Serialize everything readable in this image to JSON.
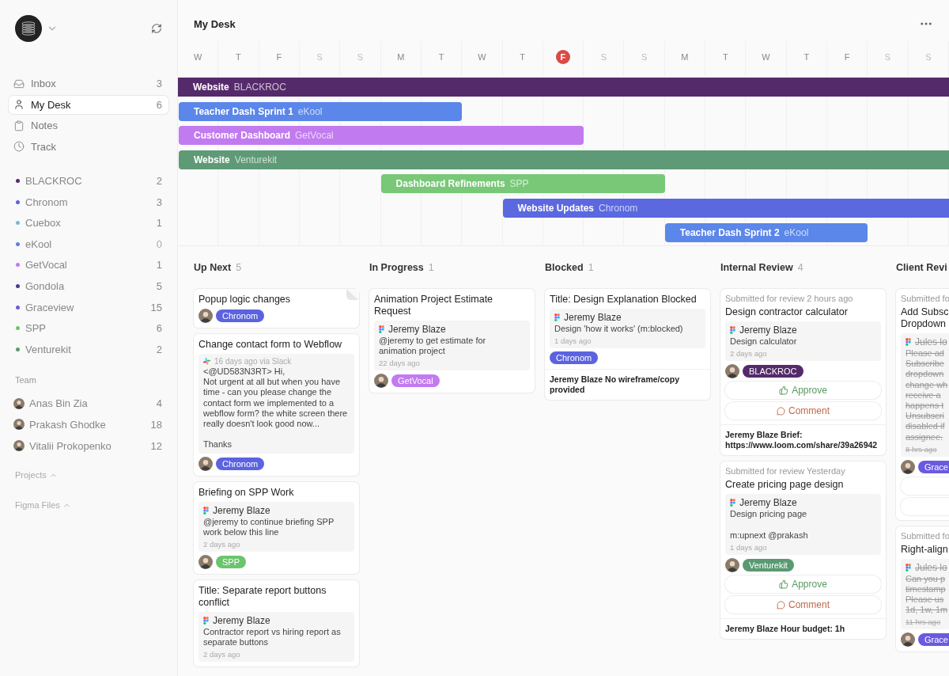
{
  "sidebar": {
    "nav": [
      {
        "kind": "inbox",
        "label": "Inbox",
        "count": "3",
        "selected": false
      },
      {
        "kind": "desk",
        "label": "My Desk",
        "count": "6",
        "selected": true
      },
      {
        "kind": "notes",
        "label": "Notes",
        "selected": false
      },
      {
        "kind": "track",
        "label": "Track",
        "selected": false
      }
    ],
    "projects": [
      {
        "label": "BLACKROC",
        "count": "2",
        "color": "#552a6a"
      },
      {
        "label": "Chronom",
        "count": "3",
        "color": "#5b63e0"
      },
      {
        "label": "Cuebox",
        "count": "1",
        "color": "#7ab8d6"
      },
      {
        "label": "eKool",
        "count": "0",
        "color": "#5b80e0"
      },
      {
        "label": "GetVocal",
        "count": "1",
        "color": "#c27af0"
      },
      {
        "label": "Gondola",
        "count": "5",
        "color": "#3f3f8f"
      },
      {
        "label": "Graceview",
        "count": "15",
        "color": "#6a5ae0"
      },
      {
        "label": "SPP",
        "count": "6",
        "color": "#6cc46e"
      },
      {
        "label": "Venturekit",
        "count": "2",
        "color": "#5a9a72"
      }
    ],
    "team": {
      "title": "Team",
      "members": [
        {
          "name": "Anas Bin Zia",
          "count": "4"
        },
        {
          "name": "Prakash Ghodke",
          "count": "18"
        },
        {
          "name": "Vitalii Prokopenko",
          "count": "12"
        }
      ]
    },
    "sections": [
      {
        "label": "Projects",
        "expanded": false
      },
      {
        "label": "Figma Files",
        "expanded": false
      }
    ]
  },
  "header": {
    "title": "My Desk"
  },
  "timeline": {
    "days": [
      {
        "label": "W",
        "weekend": false,
        "today": false
      },
      {
        "label": "T",
        "weekend": false,
        "today": false
      },
      {
        "label": "F",
        "weekend": false,
        "today": false
      },
      {
        "label": "S",
        "weekend": true,
        "today": false
      },
      {
        "label": "S",
        "weekend": true,
        "today": false
      },
      {
        "label": "M",
        "weekend": false,
        "today": false
      },
      {
        "label": "T",
        "weekend": false,
        "today": false
      },
      {
        "label": "W",
        "weekend": false,
        "today": false
      },
      {
        "label": "T",
        "weekend": false,
        "today": false
      },
      {
        "label": "F",
        "weekend": false,
        "today": true
      },
      {
        "label": "S",
        "weekend": true,
        "today": false
      },
      {
        "label": "S",
        "weekend": true,
        "today": false
      },
      {
        "label": "M",
        "weekend": false,
        "today": false
      },
      {
        "label": "T",
        "weekend": false,
        "today": false
      },
      {
        "label": "W",
        "weekend": false,
        "today": false
      },
      {
        "label": "T",
        "weekend": false,
        "today": false
      },
      {
        "label": "F",
        "weekend": false,
        "today": false
      },
      {
        "label": "S",
        "weekend": true,
        "today": false
      },
      {
        "label": "S",
        "weekend": true,
        "today": false
      }
    ],
    "bars": [
      {
        "title": "Website",
        "project": "BLACKROC",
        "color": "#552a6a"
      },
      {
        "title": "Teacher Dash Sprint 1",
        "project": "eKool",
        "color": "#5b86ea"
      },
      {
        "title": "Customer Dashboard",
        "project": "GetVocal",
        "color": "#c27af0"
      },
      {
        "title": "Website",
        "project": "Venturekit",
        "color": "#5e9a76"
      },
      {
        "title": "Dashboard Refinements",
        "project": "SPP",
        "color": "#78c878"
      },
      {
        "title": "Website Updates",
        "project": "Chronom",
        "color": "#5b68e0"
      },
      {
        "title": "Teacher Dash Sprint 2",
        "project": "eKool",
        "color": "#5b86ea"
      }
    ]
  },
  "board": [
    {
      "title": "Up Next",
      "count": "5",
      "cards": [
        {
          "title": "Popup logic changes",
          "folded": true,
          "avatar": true,
          "tag": {
            "label": "Chronom",
            "color": "#5b63e0"
          }
        },
        {
          "title": "Change contact form to Webflow",
          "folded": false,
          "note": {
            "kind": "slack",
            "meta": "16 days ago via Slack",
            "text": "<@UD583N3RT> Hi,\nNot urgent at all but when you have time - can you please change the contact form we implemented to a webflow form? the white screen there really doesn't look good now...\n\nThanks",
            "struck": false
          },
          "avatar": true,
          "tag": {
            "label": "Chronom",
            "color": "#5b63e0"
          }
        },
        {
          "title": "Briefing on SPP Work",
          "folded": false,
          "note": {
            "kind": "figma",
            "author": "Jeremy Blaze",
            "text": "@jeremy to continue briefing SPP work below this line",
            "time": "2 days ago",
            "struck": false
          },
          "avatar": true,
          "tag": {
            "label": "SPP",
            "color": "#6cc46e"
          }
        },
        {
          "title": "Title: Separate report buttons conflict",
          "folded": false,
          "note": {
            "kind": "figma",
            "author": "Jeremy Blaze",
            "text": "Contractor report vs hiring report as separate buttons",
            "time": "2 days ago",
            "struck": false
          },
          "avatar": false
        }
      ]
    },
    {
      "title": "In Progress",
      "count": "1",
      "cards": [
        {
          "title": "Animation Project Estimate Request",
          "folded": false,
          "note": {
            "kind": "figma",
            "author": "Jeremy Blaze",
            "text": "@jeremy to get estimate for animation project",
            "time": "22 days ago",
            "struck": false
          },
          "avatar": true,
          "tag": {
            "label": "GetVocal",
            "color": "#c27af0"
          }
        }
      ]
    },
    {
      "title": "Blocked",
      "count": "1",
      "cards": [
        {
          "title": "Title: Design Explanation Blocked",
          "folded": false,
          "note": {
            "kind": "figma",
            "author": "Jeremy Blaze",
            "text": "Design 'how it works' (m:blocked)",
            "time": "1 days ago",
            "struck": false
          },
          "avatar": false,
          "tag": {
            "label": "Chronom",
            "color": "#5b63e0"
          },
          "footer": "Jeremy Blaze No wireframe/copy provided"
        }
      ]
    },
    {
      "title": "Internal Review",
      "count": "4",
      "cards": [
        {
          "submitted": "Submitted for review 2 hours ago",
          "title": "Design contractor calculator",
          "folded": false,
          "note": {
            "kind": "figma",
            "author": "Jeremy Blaze",
            "text": "Design calculator",
            "time": "2 days ago",
            "struck": false
          },
          "avatar": true,
          "tag": {
            "label": "BLACKROC",
            "color": "#552a6a"
          },
          "actions": [
            {
              "kind": "approve",
              "label": "Approve"
            },
            {
              "kind": "comment",
              "label": "Comment"
            }
          ],
          "footer": "Jeremy Blaze Brief: https://www.loom.com/share/39a26942"
        },
        {
          "submitted": "Submitted for review Yesterday",
          "title": "Create pricing page design",
          "folded": false,
          "note": {
            "kind": "figma",
            "author": "Jeremy Blaze",
            "text": "Design pricing page\n\nm:upnext @prakash",
            "time": "1 days ago",
            "struck": false
          },
          "avatar": true,
          "tag": {
            "label": "Venturekit",
            "color": "#5a9a72"
          },
          "actions": [
            {
              "kind": "approve",
              "label": "Approve"
            },
            {
              "kind": "comment",
              "label": "Comment"
            }
          ],
          "footer": "Jeremy Blaze Hour budget: 1h"
        }
      ]
    },
    {
      "title": "Client Revi",
      "cards": [
        {
          "submitted": "Submitted fo",
          "title": "Add Subsc\nDropdown",
          "note": {
            "kind": "figma",
            "author": "Jules lo",
            "text": "Please ad\nSubscribe\ndropdown\nchange wh\nreceive a\nhappens t\nUnsubscri\ndisabled if\nassignee.",
            "time": "8 hrs ago",
            "struck": true
          },
          "avatar": true,
          "tag": {
            "label": "Grace",
            "color": "#6a5ae0"
          },
          "actions": [
            {
              "kind": "approve"
            },
            {
              "kind": "comment"
            }
          ]
        },
        {
          "submitted": "Submitted fo",
          "title": "Right-align",
          "note": {
            "kind": "figma",
            "author": "Jules lo",
            "text": "Can you p\ntimestamp\nPlease us\n1d, 1w, 1m",
            "time": "11 hrs ago",
            "struck": true
          },
          "avatar": true,
          "tag": {
            "label": "Grace",
            "color": "#6a5ae0"
          }
        }
      ]
    }
  ]
}
